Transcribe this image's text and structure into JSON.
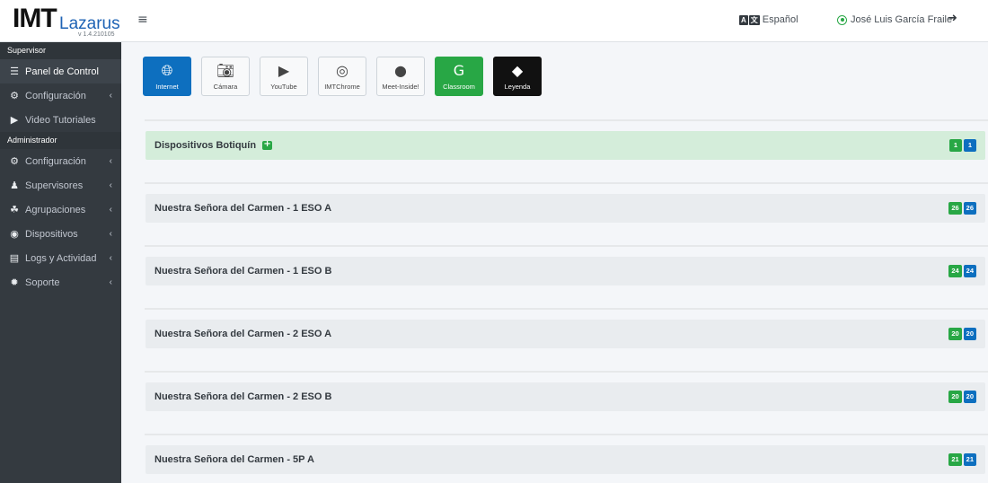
{
  "brand": {
    "imt": "IMT",
    "lazarus": "Lazarus",
    "version": "v 1.4.210105"
  },
  "sidebar": {
    "supervisor_header": "Supervisor",
    "supervisor_items": [
      {
        "label": "Panel de Control",
        "icon": "list-icon",
        "glyph": "☰",
        "chevron": ""
      },
      {
        "label": "Configuración",
        "icon": "cogs-icon",
        "glyph": "⚙",
        "chevron": "‹"
      },
      {
        "label": "Video Tutoriales",
        "icon": "play-circle-icon",
        "glyph": "▶",
        "chevron": ""
      }
    ],
    "admin_header": "Administrador",
    "admin_items": [
      {
        "label": "Configuración",
        "icon": "cogs-icon",
        "glyph": "⚙",
        "chevron": "‹"
      },
      {
        "label": "Supervisores",
        "icon": "user-tie-icon",
        "glyph": "♟",
        "chevron": "‹"
      },
      {
        "label": "Agrupaciones",
        "icon": "users-icon",
        "glyph": "☘",
        "chevron": "‹"
      },
      {
        "label": "Dispositivos",
        "icon": "shield-icon",
        "glyph": "◉",
        "chevron": "‹"
      },
      {
        "label": "Logs y Actividad",
        "icon": "file-icon",
        "glyph": "▤",
        "chevron": "‹"
      },
      {
        "label": "Soporte",
        "icon": "support-icon",
        "glyph": "✹",
        "chevron": "‹"
      }
    ]
  },
  "topbar": {
    "menu_glyph": "≡",
    "lang_label": "Español",
    "lang_icon": [
      "A",
      "文"
    ],
    "user_name": "José Luis García Fraile",
    "logout_glyph": "➜"
  },
  "toolbar": [
    {
      "label": "Internet",
      "icon": "globe-icon",
      "glyph": "🌐︎",
      "style": "blue"
    },
    {
      "label": "Cámara",
      "icon": "camera-icon",
      "glyph": "📷︎",
      "style": ""
    },
    {
      "label": "YouTube",
      "icon": "youtube-icon",
      "glyph": "▶",
      "style": ""
    },
    {
      "label": "IMTChrome",
      "icon": "chrome-icon",
      "glyph": "◎",
      "style": ""
    },
    {
      "label": "Meet-Inside!",
      "icon": "chat-icon",
      "glyph": "●",
      "style": ""
    },
    {
      "label": "Classroom",
      "icon": "google-icon",
      "glyph": "G",
      "style": "green"
    },
    {
      "label": "Leyenda",
      "icon": "tags-icon",
      "glyph": "◆",
      "style": "black"
    }
  ],
  "groups": [
    {
      "title": "Dispositivos Botiquín",
      "green": true,
      "badge_green": "1",
      "badge_blue": "1"
    },
    {
      "title": "Nuestra Señora del Carmen - 1 ESO A",
      "green": false,
      "badge_green": "26",
      "badge_blue": "26"
    },
    {
      "title": "Nuestra Señora del Carmen - 1 ESO B",
      "green": false,
      "badge_green": "24",
      "badge_blue": "24"
    },
    {
      "title": "Nuestra Señora del Carmen - 2 ESO A",
      "green": false,
      "badge_green": "20",
      "badge_blue": "20"
    },
    {
      "title": "Nuestra Señora del Carmen - 2 ESO B",
      "green": false,
      "badge_green": "20",
      "badge_blue": "20"
    },
    {
      "title": "Nuestra Señora del Carmen - 5P A",
      "green": false,
      "badge_green": "21",
      "badge_blue": "21"
    }
  ]
}
